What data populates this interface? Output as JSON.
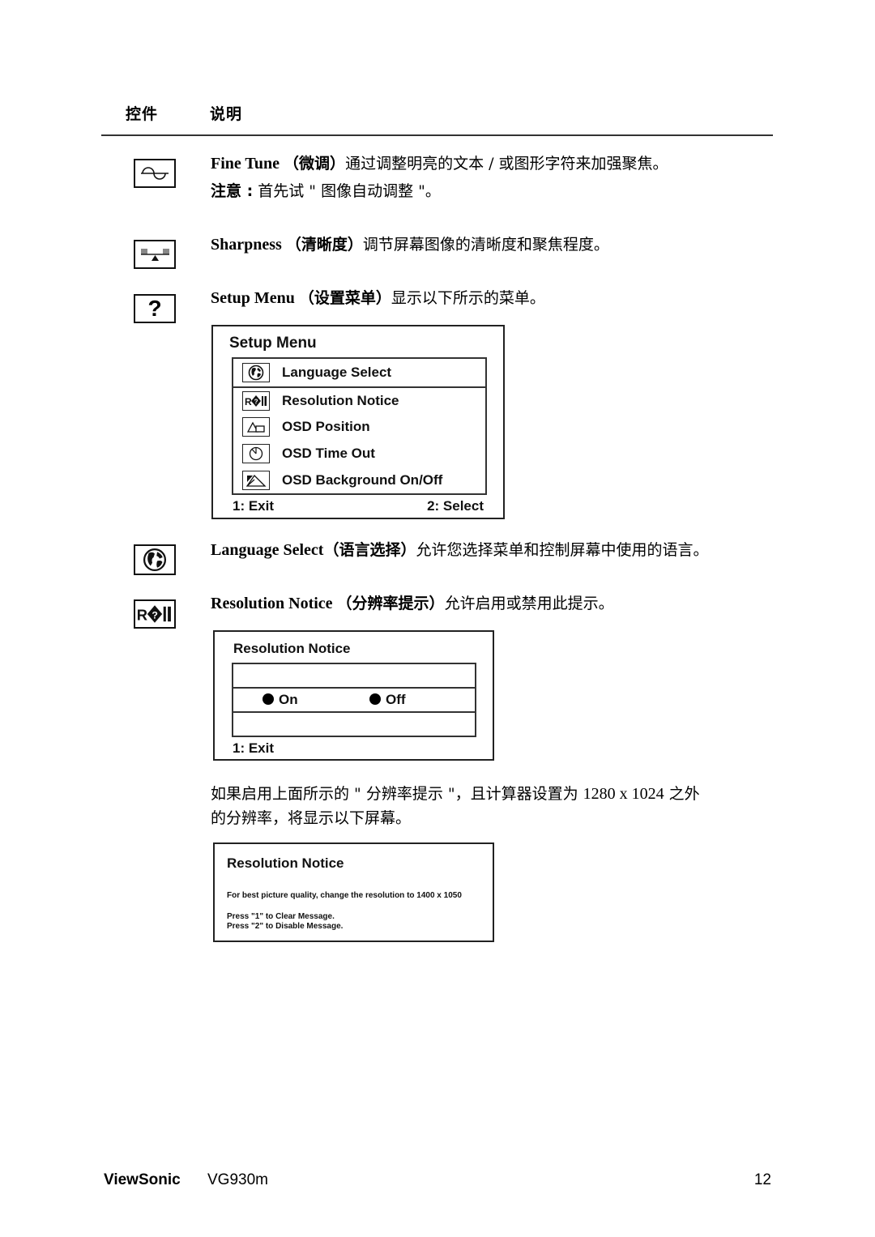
{
  "header": {
    "col_control": "控件",
    "col_description": "说明"
  },
  "items": [
    {
      "icon": "fine-tune-sine-wave-icon",
      "term": "Fine Tune",
      "term_zh": "（微调）",
      "description": "通过调整明亮的文本 / 或图形字符来加强聚焦。",
      "note_label": "注意 :",
      "note_text": " 首先试 \" 图像自动调整 \"。"
    },
    {
      "icon": "sharpness-seesaw-icon",
      "term": "Sharpness",
      "term_zh": "（清晰度）",
      "description": "调节屏幕图像的清晰度和聚焦程度。"
    },
    {
      "icon": "question-mark-icon",
      "icon_glyph": "?",
      "term": "Setup Menu",
      "term_zh": "（设置菜单）",
      "description": "显示以下所示的菜单。"
    },
    {
      "icon": "globe-icon",
      "term": "Language Select",
      "term_zh": "（语言选择）",
      "description": "允许您选择菜单和控制屏幕中使用的语言。"
    },
    {
      "icon": "resolution-notice-icon",
      "term": "Resolution Notice",
      "term_zh": "（分辨率提示）",
      "description": "允许启用或禁用此提示。"
    }
  ],
  "setup_menu": {
    "title": "Setup Menu",
    "items": [
      {
        "label": "Language Select",
        "icon": "globe-icon",
        "selected": true
      },
      {
        "label": "Resolution Notice",
        "icon": "resolution-notice-icon",
        "selected": false
      },
      {
        "label": "OSD Position",
        "icon": "osd-position-icon",
        "selected": false
      },
      {
        "label": "OSD Time Out",
        "icon": "timer-icon",
        "selected": false
      },
      {
        "label": "OSD Background On/Off",
        "icon": "osd-background-icon",
        "selected": false
      }
    ],
    "footer_left": "1: Exit",
    "footer_right": "2: Select"
  },
  "resolution_menu": {
    "title": "Resolution Notice",
    "options": [
      "On",
      "Off"
    ],
    "footer_left": "1: Exit"
  },
  "paragraph": {
    "part1": "如果启用上面所示的 \" 分辨率提示 \"，且计算器设置为 ",
    "resolution": "1280 x 1024",
    "part2": " 之外",
    "line2": "的分辨率，将显示以下屏幕。"
  },
  "resolution_message": {
    "title": "Resolution Notice",
    "message": "For best picture quality, change the resolution to 1400 x 1050",
    "line1": "Press \"1\" to Clear Message.",
    "line2": "Press \"2\" to Disable Message."
  },
  "footer": {
    "brand": "ViewSonic",
    "model": "VG930m",
    "page_number": "12"
  }
}
